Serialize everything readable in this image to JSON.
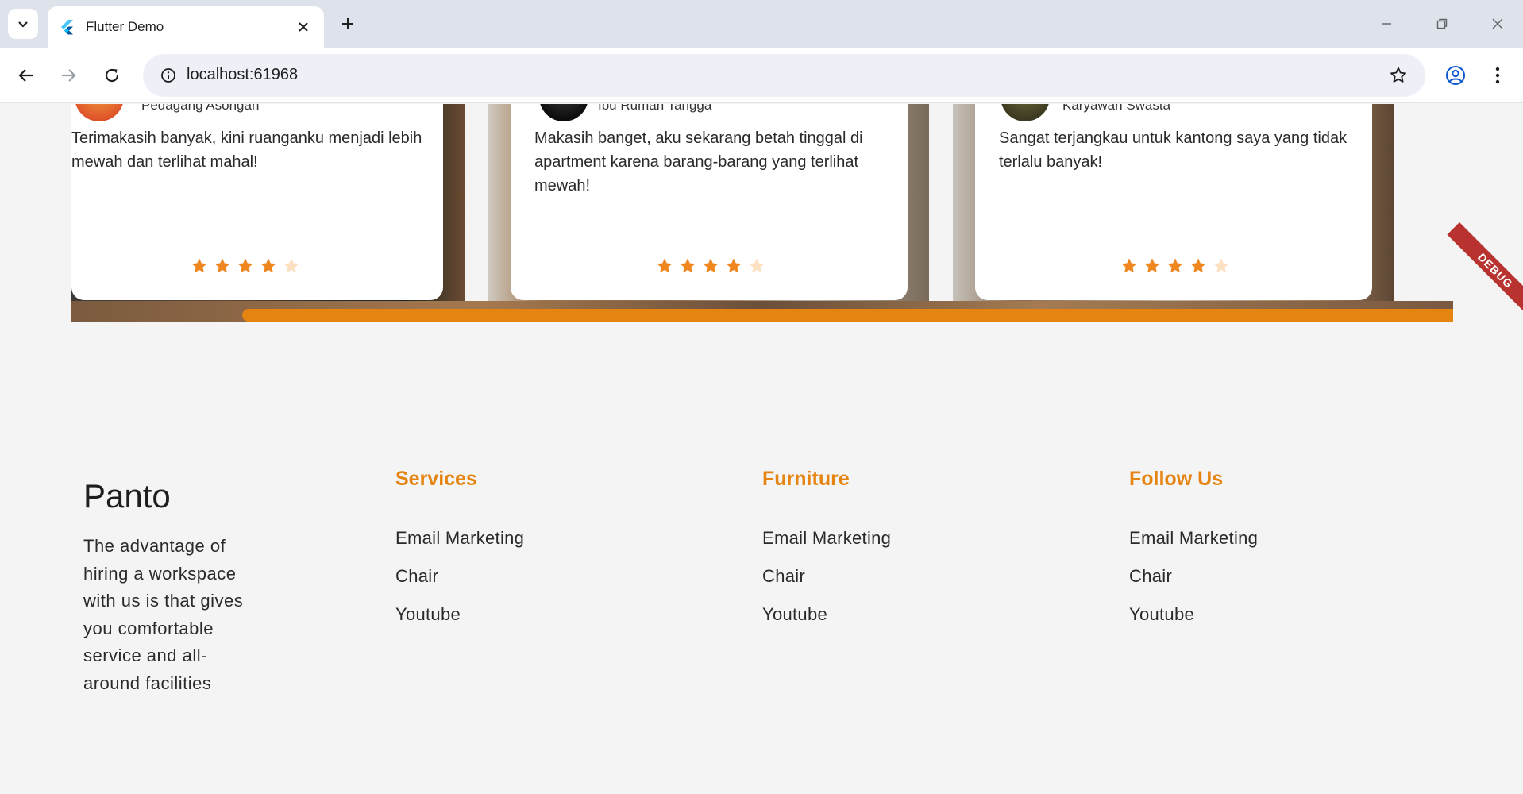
{
  "browser": {
    "tab_title": "Flutter Demo",
    "url": "localhost:61968"
  },
  "testimonials": [
    {
      "role": "Pedagang Asongan",
      "text": "Terimakasih banyak, kini ruanganku menjadi lebih mewah dan terlihat mahal!",
      "rating": 4
    },
    {
      "role": "Ibu Rumah Tangga",
      "text": "Makasih banget, aku sekarang betah tinggal di apartment karena barang-barang yang terlihat mewah!",
      "rating": 4
    },
    {
      "role": "Karyawan Swasta",
      "text": "Sangat terjangkau untuk kantong saya yang tidak terlalu banyak!",
      "rating": 4
    }
  ],
  "debug_banner": "DEBUG",
  "footer": {
    "brand": "Panto",
    "description": "The advantage of hiring a workspace with us is that gives you comfortable service and all-around facilities",
    "columns": [
      {
        "title": "Services",
        "links": [
          "Email Marketing",
          "Chair",
          "Youtube"
        ]
      },
      {
        "title": "Furniture",
        "links": [
          "Email Marketing",
          "Chair",
          "Youtube"
        ]
      },
      {
        "title": "Follow Us",
        "links": [
          "Email Marketing",
          "Chair",
          "Youtube"
        ]
      }
    ]
  },
  "colors": {
    "accent": "#e58411",
    "star_filled": "#f0861e",
    "star_empty": "#fde0c2"
  }
}
